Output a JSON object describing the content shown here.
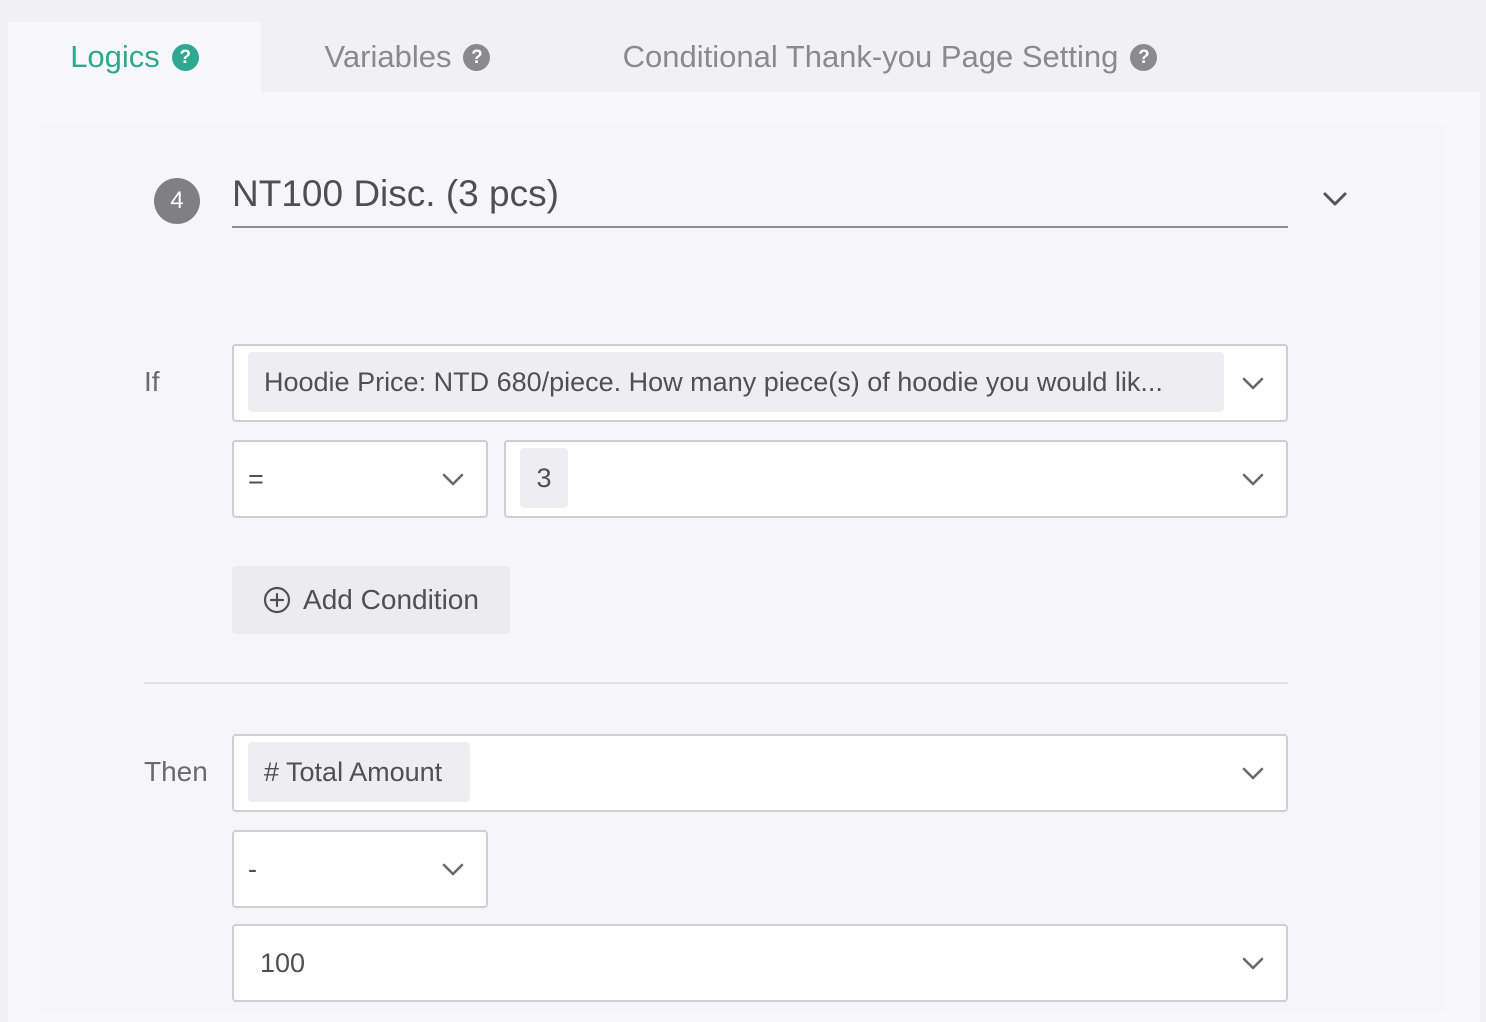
{
  "tabs": [
    {
      "label": "Logics",
      "active": true,
      "icon": "question-circle-icon"
    },
    {
      "label": "Variables",
      "active": false,
      "icon": "question-circle-icon"
    },
    {
      "label": "Conditional Thank-you Page Setting",
      "active": false,
      "icon": "question-circle-icon"
    }
  ],
  "rule": {
    "number": "4",
    "title": "NT100 Disc. (3 pcs)",
    "collapse_icon": "chevron-down-icon"
  },
  "condition": {
    "label": "If",
    "question": "Hoodie Price: NTD 680/piece. How many piece(s) of hoodie you would lik...",
    "operator": "=",
    "value": "3",
    "add_button_label": "Add Condition",
    "add_icon": "plus-circle-icon"
  },
  "action": {
    "label": "Then",
    "target": "# Total Amount",
    "operator": "-",
    "amount": "100"
  },
  "colors": {
    "accent": "#2ea891",
    "badge": "#808084",
    "text": "#555559",
    "muted": "#8a8a8e"
  }
}
